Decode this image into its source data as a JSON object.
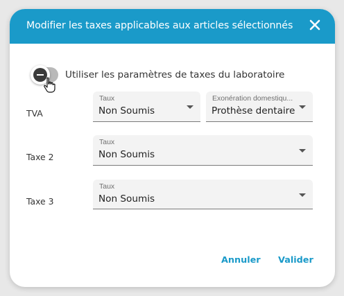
{
  "dialog": {
    "title": "Modifier les taxes applicables aux articles sélectionnés",
    "close_icon": "close-icon"
  },
  "toggle": {
    "label": "Utiliser les paramètres de taxes du laboratoire",
    "checked": false
  },
  "rows": {
    "tva": {
      "label": "TVA",
      "taux": {
        "label": "Taux",
        "value": "Non Soumis"
      },
      "exoneration": {
        "label": "Exonération domestiqu...",
        "value": "Prothèse dentaire"
      }
    },
    "taxe2": {
      "label": "Taxe 2",
      "taux": {
        "label": "Taux",
        "value": "Non Soumis"
      }
    },
    "taxe3": {
      "label": "Taxe 3",
      "taux": {
        "label": "Taux",
        "value": "Non Soumis"
      }
    }
  },
  "actions": {
    "cancel_label": "Annuler",
    "validate_label": "Valider"
  },
  "colors": {
    "accent": "#1a9ac9",
    "backdrop": "#e8e8e8",
    "field_bg": "#f3f3f3"
  }
}
